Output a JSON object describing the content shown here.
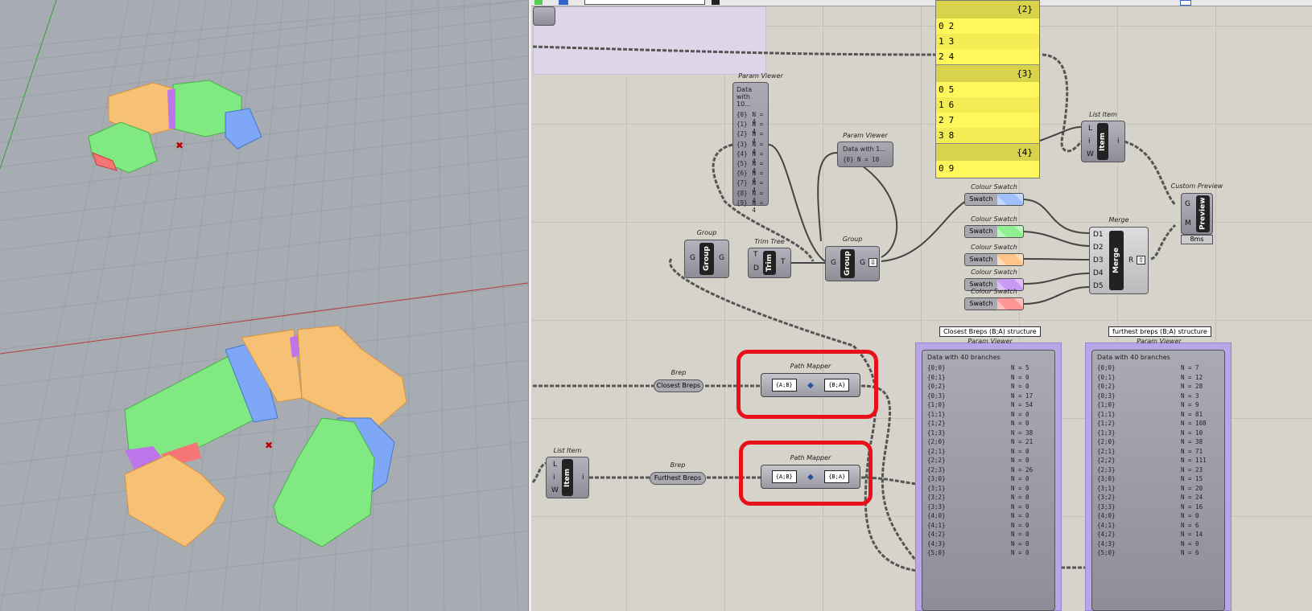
{
  "toolbar": {
    "search_value": ""
  },
  "yellow_panel": {
    "branches": [
      {
        "path": "{2}",
        "items": [
          [
            "0",
            "2"
          ],
          [
            "1",
            "3"
          ],
          [
            "2",
            "4"
          ]
        ]
      },
      {
        "path": "{3}",
        "items": [
          [
            "0",
            "5"
          ],
          [
            "1",
            "6"
          ],
          [
            "2",
            "7"
          ],
          [
            "3",
            "8"
          ]
        ]
      },
      {
        "path": "{4}",
        "items": [
          [
            "0",
            "9"
          ]
        ]
      }
    ]
  },
  "param_viewer_1": {
    "label": "Param Viewer",
    "header": "Data with 10...",
    "rows": [
      [
        "{0}",
        "N = 4"
      ],
      [
        "{1}",
        "N = 4"
      ],
      [
        "{2}",
        "N = 4"
      ],
      [
        "{3}",
        "N = 4"
      ],
      [
        "{4}",
        "N = 4"
      ],
      [
        "{5}",
        "N = 4"
      ],
      [
        "{6}",
        "N = 4"
      ],
      [
        "{7}",
        "N = 4"
      ],
      [
        "{8}",
        "N = 4"
      ],
      [
        "{9}",
        "N = 4"
      ]
    ]
  },
  "param_viewer_2": {
    "label": "Param Viewer",
    "header": "Data with 1...",
    "row": "{0} N = 10"
  },
  "list_item_top": {
    "label": "List Item",
    "name": "Item",
    "inputs": [
      "L",
      "i",
      "W"
    ],
    "output": "i"
  },
  "list_item_bottom": {
    "label": "List Item",
    "name": "Item",
    "inputs": [
      "L",
      "i",
      "W"
    ],
    "output": "i"
  },
  "swatches": [
    {
      "label": "Colour Swatch",
      "name": "Swatch",
      "color": "#9fbfff"
    },
    {
      "label": "Colour Swatch",
      "name": "Swatch",
      "color": "#8ff08f"
    },
    {
      "label": "Colour Swatch",
      "name": "Swatch",
      "color": "#ffc48a"
    },
    {
      "label": "Colour Swatch",
      "name": "Swatch",
      "color": "#c89af5"
    },
    {
      "label": "Colour Swatch",
      "name": "Swatch",
      "color": "#ff9595"
    }
  ],
  "custom_preview": {
    "label": "Custom Preview",
    "name": "Preview",
    "inputs": [
      "G",
      "M"
    ],
    "time": "8ms"
  },
  "merge": {
    "label": "Merge",
    "name": "Merge",
    "inputs": [
      "D1",
      "D2",
      "D3",
      "D4",
      "D5"
    ],
    "output": "R"
  },
  "group1": {
    "label": "Group",
    "name": "Group",
    "input": "G",
    "output": "G"
  },
  "trim_tree": {
    "label": "Trim Tree",
    "name": "Trim",
    "inputs": [
      "T",
      "D"
    ],
    "output": "T"
  },
  "group2": {
    "label": "Group",
    "name": "Group",
    "input": "G",
    "output": "G"
  },
  "brep_closest": {
    "label": "Brep",
    "name": "Closest Breps"
  },
  "brep_furthest": {
    "label": "Brep",
    "name": "Furthest Breps"
  },
  "path_mapper_1": {
    "label": "Path Mapper",
    "from": "{A;B}",
    "to": "{B;A}"
  },
  "path_mapper_2": {
    "label": "Path Mapper",
    "from": "{A;B}",
    "to": "{B;A}"
  },
  "closest_viewer": {
    "tag": "Closest Breps (B;A) structure",
    "label": "Param Viewer",
    "header": "Data with 40 branches",
    "rows": [
      [
        "{0;0}",
        "N = 5"
      ],
      [
        "{0;1}",
        "N = 0"
      ],
      [
        "{0;2}",
        "N = 0"
      ],
      [
        "{0;3}",
        "N = 17"
      ],
      [
        "{1;0}",
        "N = 54"
      ],
      [
        "{1;1}",
        "N = 0"
      ],
      [
        "{1;2}",
        "N = 0"
      ],
      [
        "{1;3}",
        "N = 38"
      ],
      [
        "{2;0}",
        "N = 21"
      ],
      [
        "{2;1}",
        "N = 0"
      ],
      [
        "{2;2}",
        "N = 0"
      ],
      [
        "{2;3}",
        "N = 26"
      ],
      [
        "{3;0}",
        "N = 0"
      ],
      [
        "{3;1}",
        "N = 0"
      ],
      [
        "{3;2}",
        "N = 0"
      ],
      [
        "{3;3}",
        "N = 0"
      ],
      [
        "{4;0}",
        "N = 0"
      ],
      [
        "{4;1}",
        "N = 0"
      ],
      [
        "{4;2}",
        "N = 0"
      ],
      [
        "{4;3}",
        "N = 0"
      ],
      [
        "{5;0}",
        "N = 0"
      ]
    ]
  },
  "furthest_viewer": {
    "tag": "furthest breps (B;A) structure",
    "label": "Param Viewer",
    "header": "Data with 40 branches",
    "rows": [
      [
        "{0;0}",
        "N = 7"
      ],
      [
        "{0;1}",
        "N = 12"
      ],
      [
        "{0;2}",
        "N = 28"
      ],
      [
        "{0;3}",
        "N = 3"
      ],
      [
        "{1;0}",
        "N = 9"
      ],
      [
        "{1;1}",
        "N = 81"
      ],
      [
        "{1;2}",
        "N = 108"
      ],
      [
        "{1;3}",
        "N = 10"
      ],
      [
        "{2;0}",
        "N = 38"
      ],
      [
        "{2;1}",
        "N = 71"
      ],
      [
        "{2;2}",
        "N = 111"
      ],
      [
        "{2;3}",
        "N = 23"
      ],
      [
        "{3;0}",
        "N = 15"
      ],
      [
        "{3;1}",
        "N = 20"
      ],
      [
        "{3;2}",
        "N = 24"
      ],
      [
        "{3;3}",
        "N = 16"
      ],
      [
        "{4;0}",
        "N = 0"
      ],
      [
        "{4;1}",
        "N = 6"
      ],
      [
        "{4;2}",
        "N = 14"
      ],
      [
        "{4;3}",
        "N = 0"
      ],
      [
        "{5;0}",
        "N = 6"
      ]
    ]
  }
}
